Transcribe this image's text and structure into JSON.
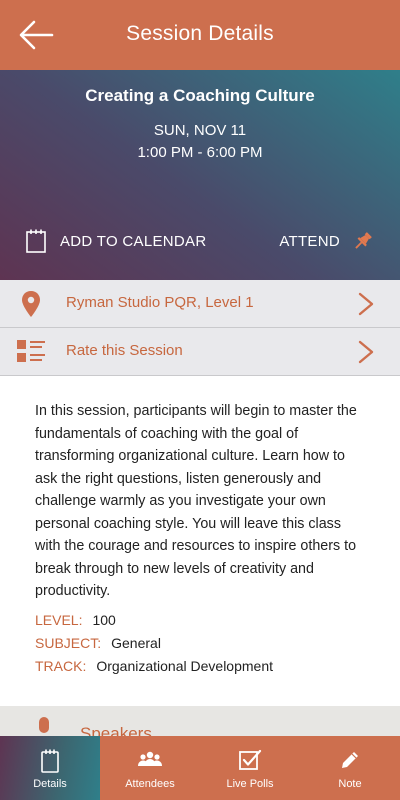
{
  "header": {
    "title": "Session Details",
    "back_icon": "arrow-left-icon"
  },
  "session": {
    "title": "Creating a Coaching Culture",
    "date": "SUN, NOV 11",
    "time": "1:00 PM - 6:00 PM",
    "add_to_calendar_label": "ADD TO CALENDAR",
    "attend_label": "ATTEND"
  },
  "location_row": {
    "label": "Ryman Studio PQR, Level 1",
    "icon": "map-pin-icon"
  },
  "rate_row": {
    "label": "Rate this Session",
    "icon": "rating-list-icon"
  },
  "description": "In this session, participants will begin to master the fundamentals of coaching with the goal of transforming organizational culture. Learn how to ask the right questions, listen generously and challenge warmly as you investigate your own personal coaching style. You will leave this class with the courage and resources to inspire others to break through to new levels of creativity and productivity.",
  "meta": {
    "level_key": "LEVEL:",
    "level_value": "100",
    "subject_key": "SUBJECT:",
    "subject_value": "General",
    "track_key": "TRACK:",
    "track_value": "Organizational Development"
  },
  "speakers": {
    "label": "Speakers"
  },
  "tabs": [
    {
      "label": "Details",
      "icon": "notepad-icon",
      "active": true
    },
    {
      "label": "Attendees",
      "icon": "people-icon",
      "active": false
    },
    {
      "label": "Live Polls",
      "icon": "checkbox-icon",
      "active": false
    },
    {
      "label": "Note",
      "icon": "pencil-icon",
      "active": false
    }
  ],
  "colors": {
    "accent": "#cd6f4e",
    "accent_text": "#c7673f",
    "row_bg": "#e9e9ec",
    "hero_gradient_start": "#5e3452",
    "hero_gradient_end": "#2f7f8a"
  }
}
